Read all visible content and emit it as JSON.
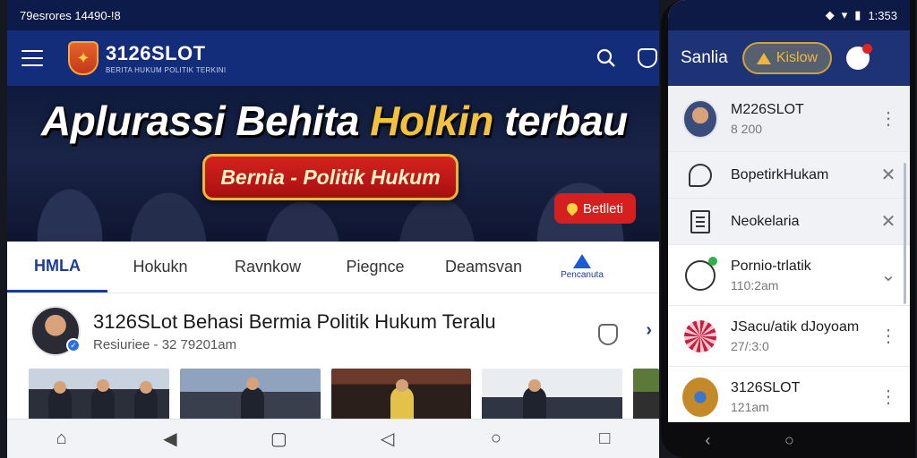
{
  "left": {
    "status": {
      "left_text": "79esrores 14490-!8",
      "right_icon": "signal-icon"
    },
    "appbar": {
      "logo_name": "3126SLOT",
      "logo_tag": "BERITA HUKUM POLITIK TERKINI"
    },
    "banner": {
      "headline_white": "Aplurassi Behita ",
      "headline_gold": "Holkin",
      "headline_white2": " terbau",
      "pill": "Bernia - Politik Hukum",
      "live": "Betlleti"
    },
    "tabs": [
      {
        "label": "HMLA"
      },
      {
        "label": "Hokukn"
      },
      {
        "label": "Ravnkow"
      },
      {
        "label": "Piegnce"
      },
      {
        "label": "Deamsvan"
      },
      {
        "label": "Pencanuta"
      }
    ],
    "post": {
      "title": "3126SLot Behasi Bermia Politik Hukum Teralu",
      "sub": "Resiuriee - 32 79201am"
    }
  },
  "right": {
    "status_time": "1:353",
    "appbar": {
      "title": "Sanlia",
      "follow": "Kislow"
    },
    "items": [
      {
        "l1": "M226SLOT",
        "l2": "8 200"
      },
      {
        "l1": "BopetirkHukam",
        "l2": ""
      },
      {
        "l1": "Neokelaria",
        "l2": ""
      },
      {
        "l1": "Pornio-trlatik",
        "l2": "110:2am"
      },
      {
        "l1": "JSacu/atik dJoyoam",
        "l2": "27/:3:0"
      },
      {
        "l1": "3126SLOT",
        "l2": "121am"
      }
    ]
  },
  "colors": {
    "brand_navy": "#142d7a",
    "accent_red": "#d5231f",
    "accent_gold": "#f3c23a"
  }
}
